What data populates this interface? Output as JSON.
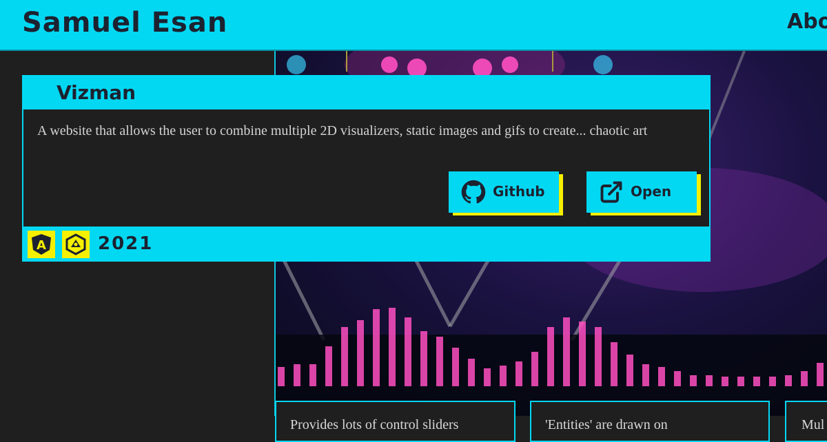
{
  "header": {
    "site_title": "Samuel Esan",
    "nav_about": "About"
  },
  "project": {
    "title": "Vizman",
    "description": "A website that allows the user to combine multiple 2D visualizers, static images and gifs to create... chaotic art",
    "buttons": [
      {
        "label": "Github",
        "icon": "github-icon"
      },
      {
        "label": "Open",
        "icon": "external-link-icon"
      }
    ],
    "tech_icons": [
      "angular-icon",
      "ionic-icon"
    ],
    "year": "2021"
  },
  "features": [
    "Provides lots of control sliders",
    "'Entities' are drawn on",
    "Mul"
  ],
  "colors": {
    "accent": "#03d8f3",
    "highlight": "#f5ef00",
    "background": "#1f1f1f",
    "text_dark": "#1c2230",
    "visualizer_bars": "#ff4fc1"
  }
}
